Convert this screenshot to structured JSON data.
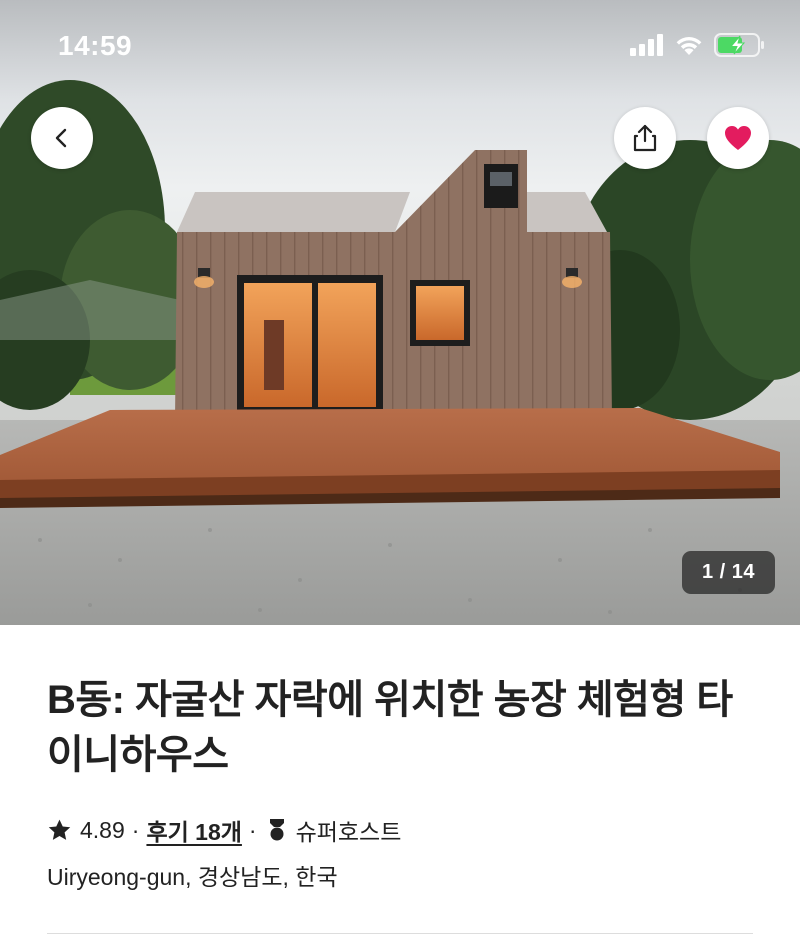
{
  "status_bar": {
    "time": "14:59",
    "icons": [
      "cellular-signal-icon",
      "wifi-icon",
      "battery-charging-icon"
    ],
    "battery_color": "#4cd964"
  },
  "hero": {
    "photo_description_icon": "listing-photo",
    "photo_counter": "1 / 14",
    "buttons": {
      "back_icon": "chevron-left-icon",
      "share_icon": "share-icon",
      "favorite_icon": "heart-icon",
      "favorite_active": true,
      "favorite_color": "#e31c5f"
    }
  },
  "listing": {
    "title": "B동: 자굴산 자락에 위치한 농장 체험형 타이니하우스",
    "rating": "4.89",
    "separator": "·",
    "reviews_label": "후기 18개",
    "superhost_label": "슈퍼호스트",
    "location": "Uiryeong-gun, 경상남도, 한국"
  },
  "colors": {
    "text": "#222222",
    "divider": "#dddddd",
    "counter_bg": "#222222"
  }
}
